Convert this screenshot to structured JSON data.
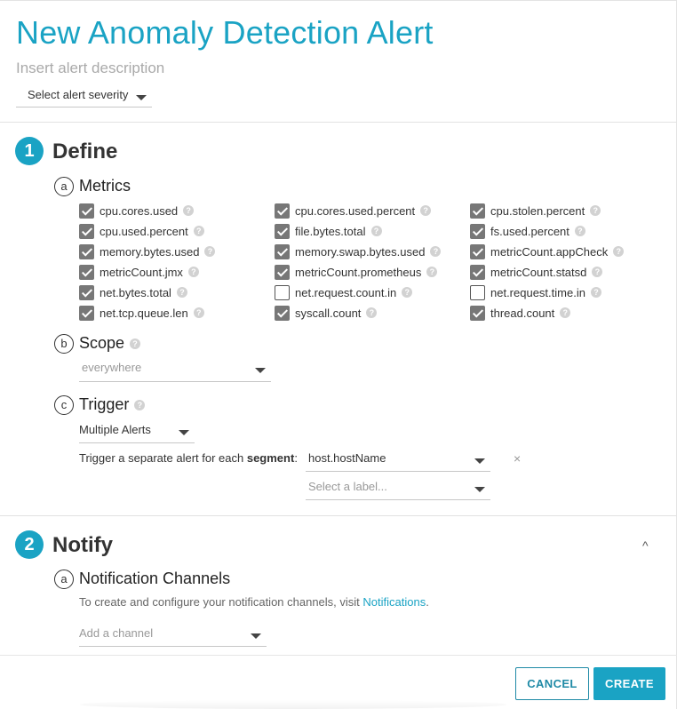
{
  "header": {
    "title": "New Anomaly Detection Alert",
    "description_placeholder": "Insert alert description",
    "severity_placeholder": "Select alert severity"
  },
  "define": {
    "step_number": "1",
    "title": "Define",
    "metrics": {
      "letter": "a",
      "title": "Metrics",
      "items": [
        {
          "label": "cpu.cores.used",
          "checked": true
        },
        {
          "label": "cpu.cores.used.percent",
          "checked": true
        },
        {
          "label": "cpu.stolen.percent",
          "checked": true
        },
        {
          "label": "cpu.used.percent",
          "checked": true
        },
        {
          "label": "file.bytes.total",
          "checked": true
        },
        {
          "label": "fs.used.percent",
          "checked": true
        },
        {
          "label": "memory.bytes.used",
          "checked": true
        },
        {
          "label": "memory.swap.bytes.used",
          "checked": true
        },
        {
          "label": "metricCount.appCheck",
          "checked": true
        },
        {
          "label": "metricCount.jmx",
          "checked": true
        },
        {
          "label": "metricCount.prometheus",
          "checked": true
        },
        {
          "label": "metricCount.statsd",
          "checked": true
        },
        {
          "label": "net.bytes.total",
          "checked": true
        },
        {
          "label": "net.request.count.in",
          "checked": false
        },
        {
          "label": "net.request.time.in",
          "checked": false
        },
        {
          "label": "net.tcp.queue.len",
          "checked": true
        },
        {
          "label": "syscall.count",
          "checked": true
        },
        {
          "label": "thread.count",
          "checked": true
        }
      ]
    },
    "scope": {
      "letter": "b",
      "title": "Scope",
      "placeholder": "everywhere"
    },
    "trigger": {
      "letter": "c",
      "title": "Trigger",
      "mode": "Multiple Alerts",
      "segment_prefix": "Trigger a separate alert for each ",
      "segment_bold": "segment",
      "segment_suffix": ":",
      "segment_value": "host.hostName",
      "label_placeholder": "Select a label...",
      "remove_symbol": "×"
    }
  },
  "notify": {
    "step_number": "2",
    "title": "Notify",
    "collapse_symbol": "^",
    "channels": {
      "letter": "a",
      "title": "Notification Channels",
      "note_prefix": "To create and configure your notification channels, visit ",
      "note_link": "Notifications",
      "note_suffix": ".",
      "placeholder": "Add a channel"
    }
  },
  "footer": {
    "cancel_label": "CANCEL",
    "create_label": "CREATE"
  },
  "help_symbol": "?"
}
